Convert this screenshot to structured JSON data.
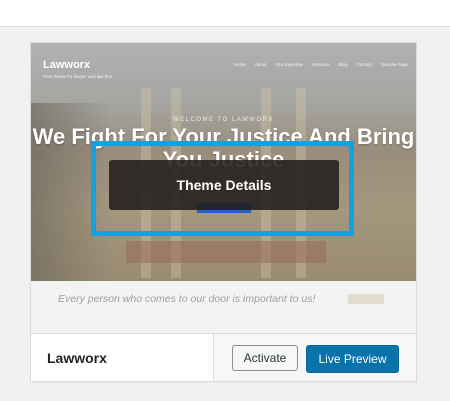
{
  "theme_card": {
    "name": "Lawworx",
    "details_button": "Theme Details",
    "activate_button": "Activate",
    "preview_button": "Live Preview",
    "colors": {
      "highlight": "#16a0e0",
      "primary_button": "#0a73aa"
    }
  },
  "screenshot": {
    "site_title": "Lawworx",
    "site_tagline": "Free theme for lawyer and law firm",
    "nav": [
      "Home",
      "About",
      "Our Expertise",
      "Services",
      "Blog",
      "Contact",
      "Sample Page"
    ],
    "hero_kicker": "WELCOME TO LAWWORX",
    "hero_title": "We Fight For Your Justice And Bring You Justice",
    "tagline_text": "Every person who comes to our door is important to us!"
  }
}
